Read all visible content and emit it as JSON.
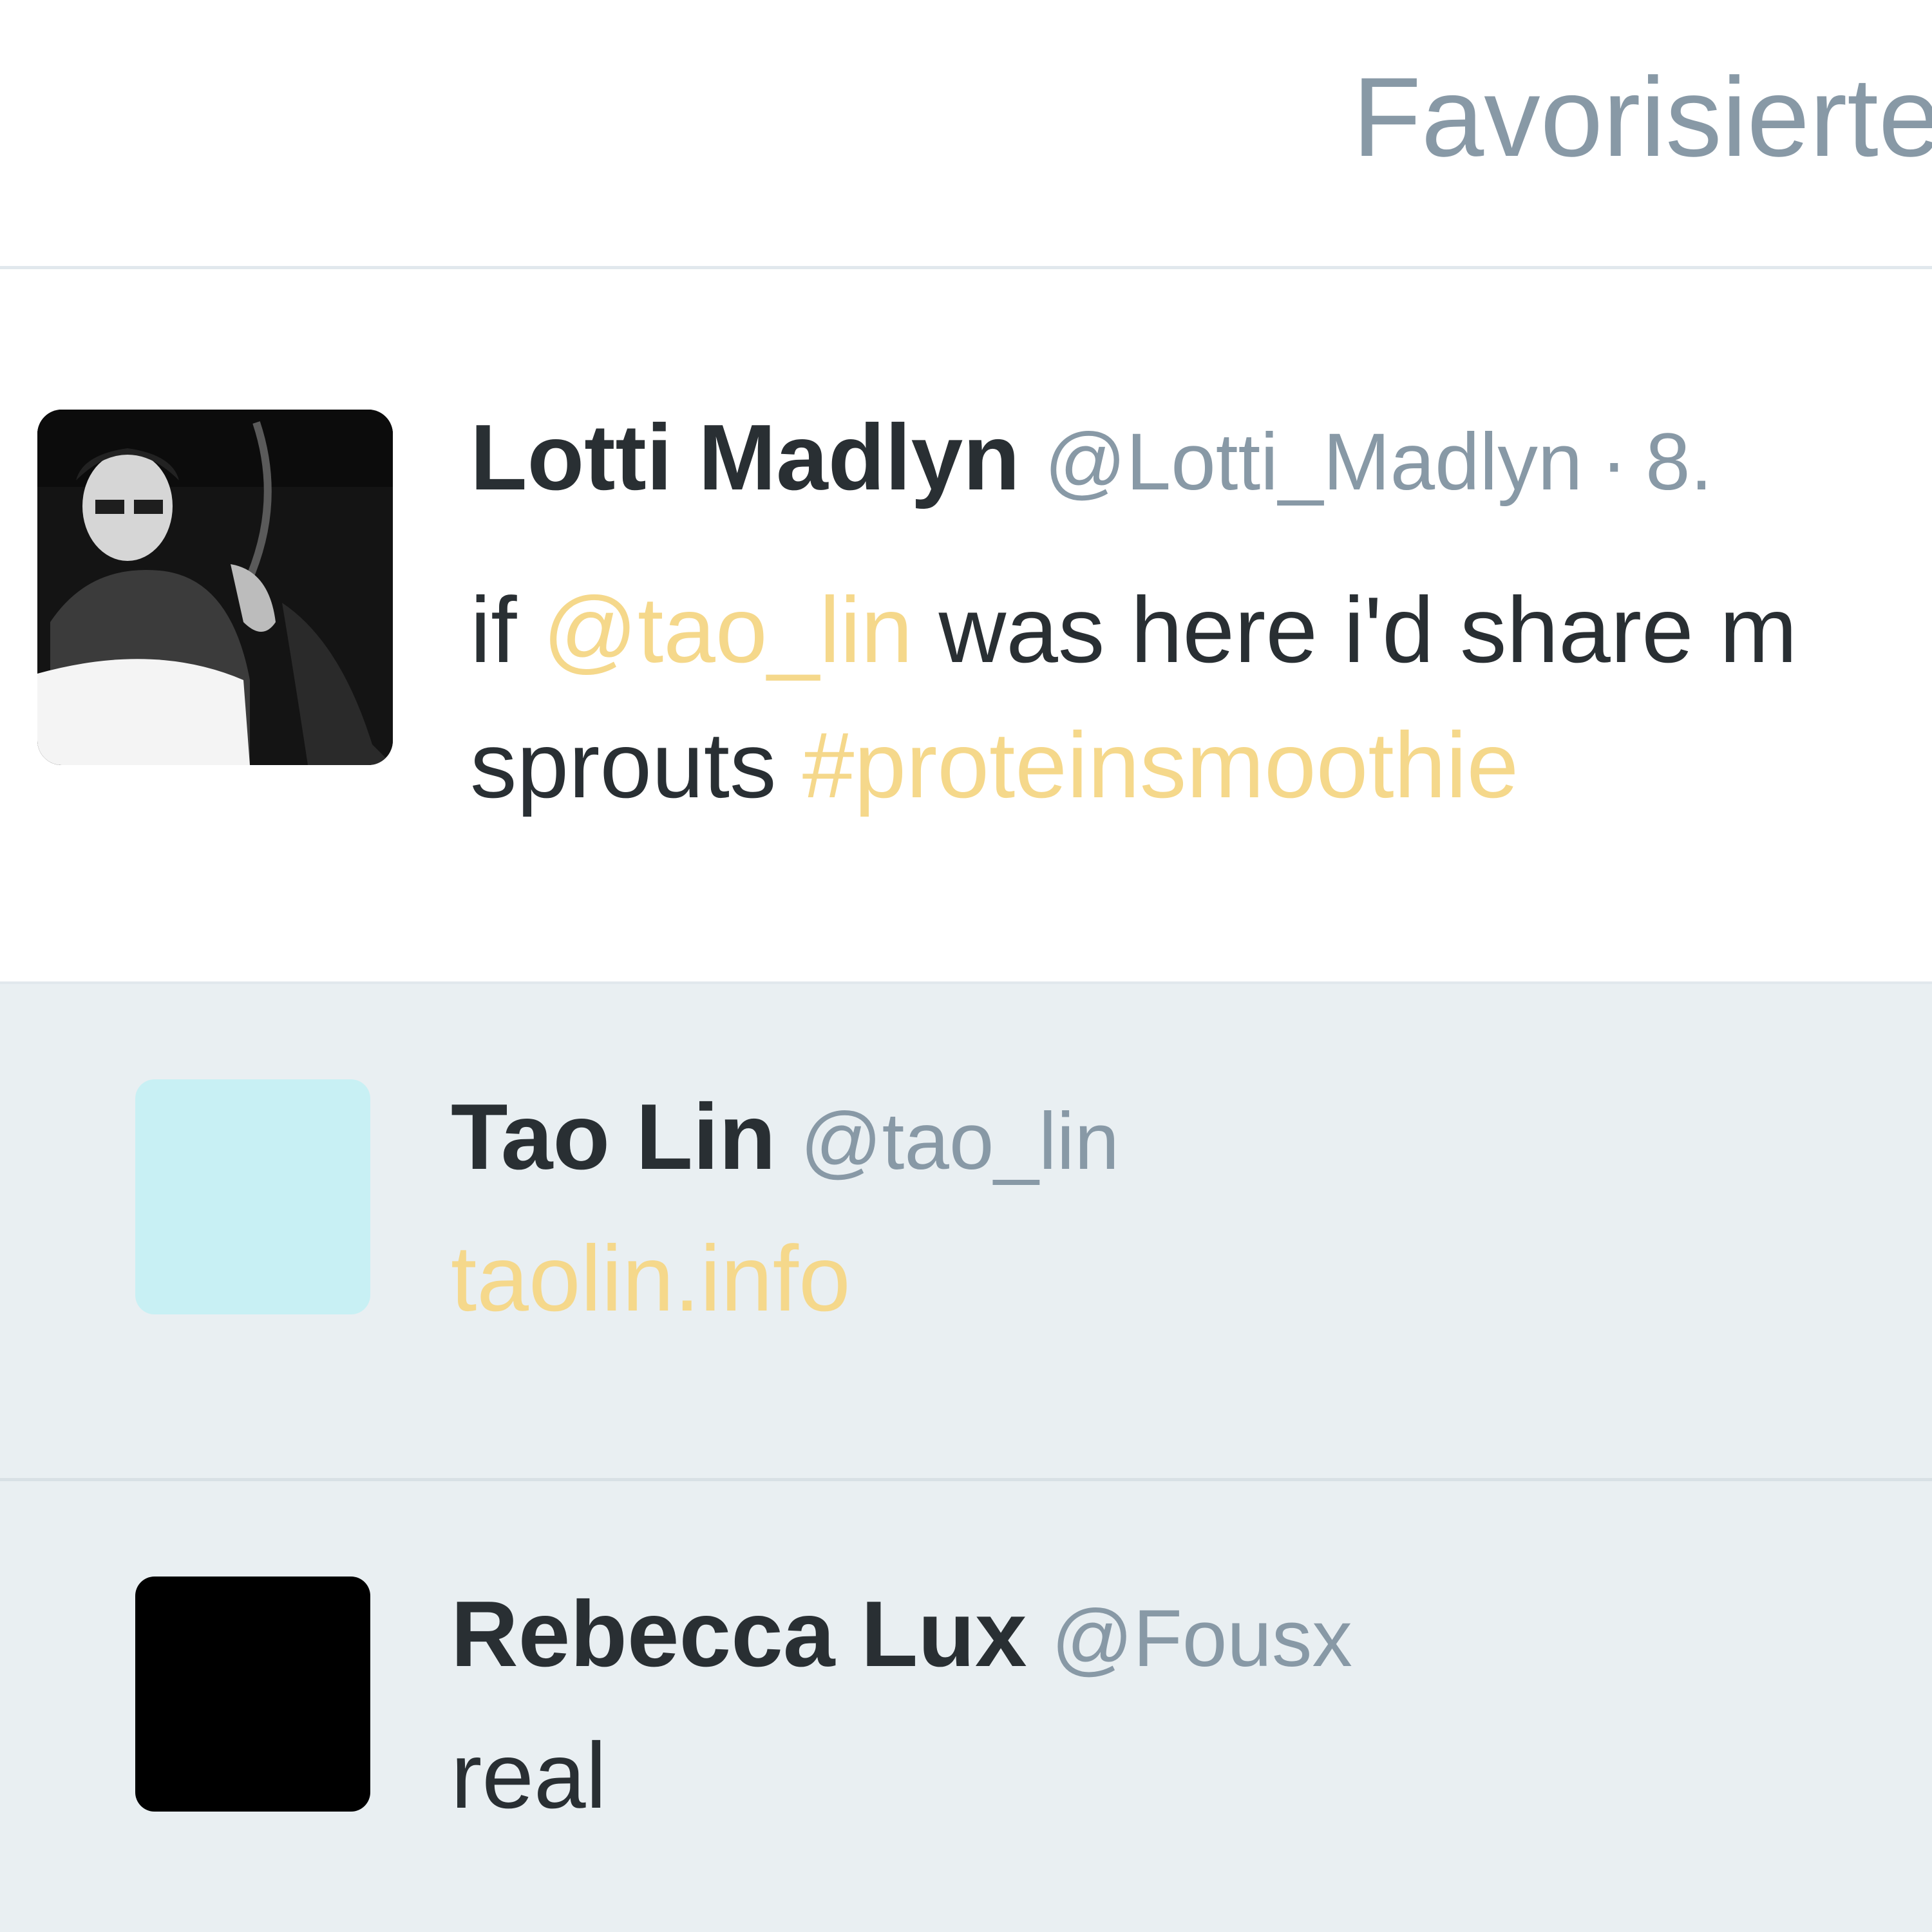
{
  "header": {
    "tab_label": "Favorisierte"
  },
  "tweet": {
    "fullname": "Lotti Madlyn",
    "screenname": "@Lotti_Madlyn",
    "separator": "·",
    "time": "8.",
    "text_prefix": "if ",
    "mention": "@tao_lin",
    "text_middle": " was here i'd share m",
    "text_line2": "sprouts ",
    "hashtag": "#proteinsmoothie"
  },
  "conversation": [
    {
      "fullname": "Tao Lin",
      "screenname": "@tao_lin",
      "text": "taolin.info",
      "avatar_color": "#c8f0f4"
    },
    {
      "fullname": "Rebecca Lux",
      "screenname": "@Fousx",
      "text": "real",
      "avatar_color": "#000000"
    }
  ],
  "colors": {
    "link": "#f5d88b",
    "muted": "#8899a6",
    "text": "#292f33",
    "conversation_bg": "#e9eff2"
  }
}
